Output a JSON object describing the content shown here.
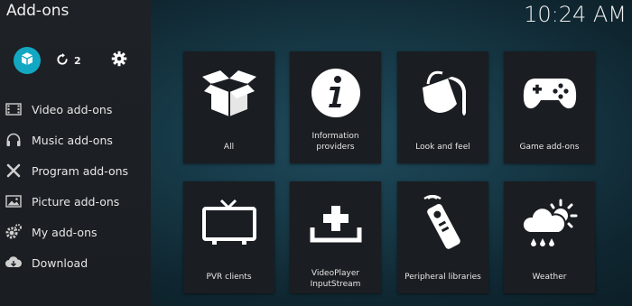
{
  "header": {
    "title": "Add-ons",
    "clock": "10:24 AM"
  },
  "toolbar": {
    "update_count": "2"
  },
  "sidebar": {
    "items": [
      {
        "label": "Video add-ons",
        "icon": "film-icon"
      },
      {
        "label": "Music add-ons",
        "icon": "headphones-icon"
      },
      {
        "label": "Program add-ons",
        "icon": "tools-icon"
      },
      {
        "label": "Picture add-ons",
        "icon": "picture-icon"
      },
      {
        "label": "My add-ons",
        "icon": "gears-icon"
      },
      {
        "label": "Download",
        "icon": "cloud-download-icon"
      }
    ]
  },
  "tiles": [
    {
      "label": "All",
      "icon": "open-box-icon"
    },
    {
      "label": "Information providers",
      "icon": "info-icon"
    },
    {
      "label": "Look and feel",
      "icon": "paint-bucket-icon"
    },
    {
      "label": "Game add-ons",
      "icon": "gamepad-icon"
    },
    {
      "label": "PVR clients",
      "icon": "tv-icon"
    },
    {
      "label": "VideoPlayer",
      "label2": "InputStream",
      "icon": "inputstream-icon"
    },
    {
      "label": "Peripheral libraries",
      "icon": "remote-icon"
    },
    {
      "label": "Weather",
      "icon": "weather-icon"
    }
  ],
  "colors": {
    "accent": "#12a8c4",
    "tile_bg": "#1a1d21",
    "sidebar_bg": "#1e2226"
  }
}
